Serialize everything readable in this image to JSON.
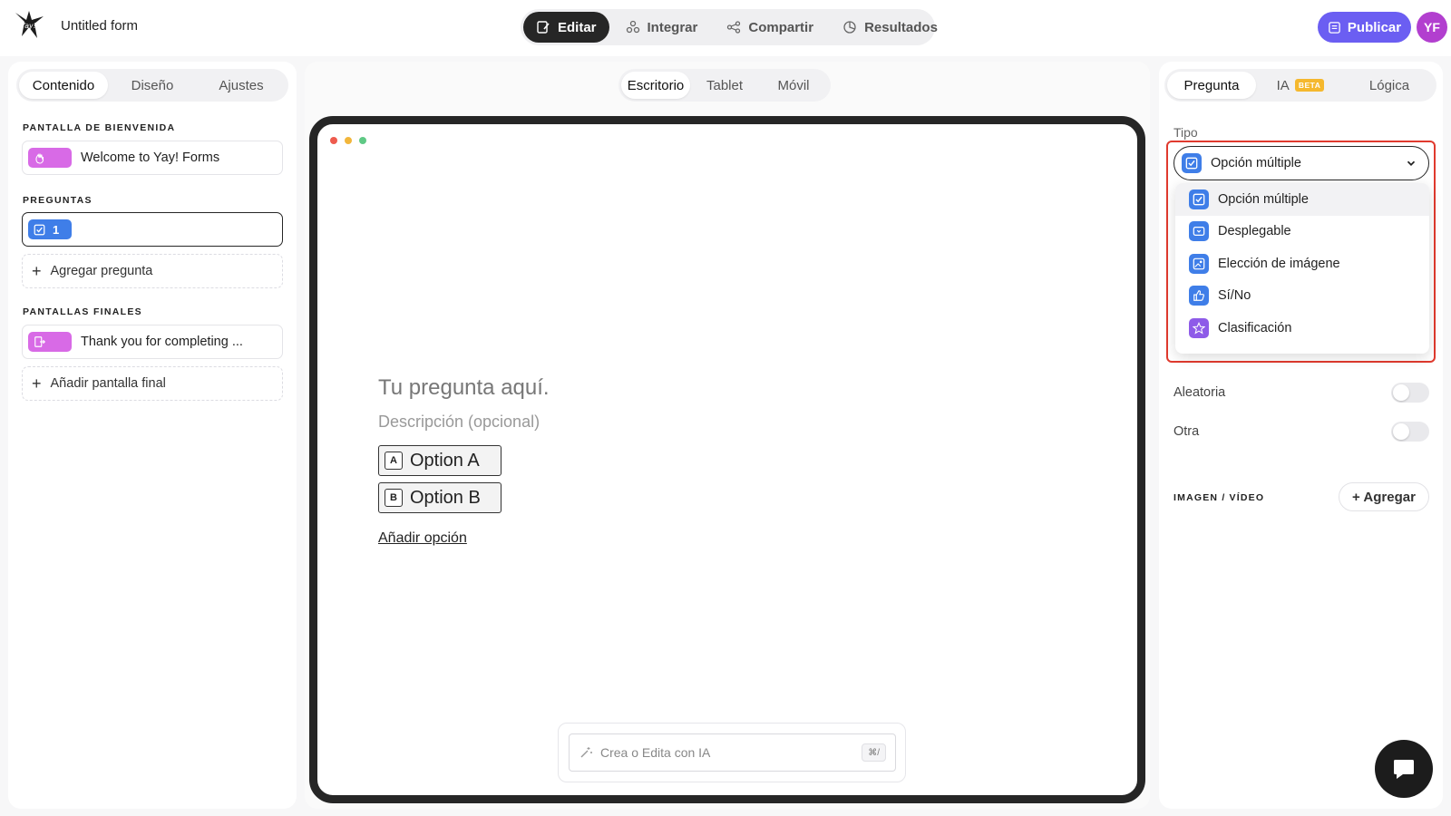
{
  "header": {
    "form_title": "Untitled form",
    "nav": [
      {
        "label": "Editar",
        "active": true
      },
      {
        "label": "Integrar",
        "active": false
      },
      {
        "label": "Compartir",
        "active": false
      },
      {
        "label": "Resultados",
        "active": false
      }
    ],
    "publish_label": "Publicar",
    "avatar_initials": "YF"
  },
  "left": {
    "tabs": [
      "Contenido",
      "Diseño",
      "Ajustes"
    ],
    "welcome_label": "PANTALLA DE BIENVENIDA",
    "welcome_card": "Welcome to Yay! Forms",
    "questions_label": "PREGUNTAS",
    "question_number": "1",
    "add_question": "Agregar pregunta",
    "endings_label": "PANTALLAS FINALES",
    "ending_card": "Thank you for completing ...",
    "add_ending": "Añadir pantalla final"
  },
  "center": {
    "device_tabs": [
      "Escritorio",
      "Tablet",
      "Móvil"
    ],
    "question_title": "Tu pregunta aquí.",
    "question_desc": "Descripción (opcional)",
    "options": [
      {
        "key": "A",
        "label": "Option A"
      },
      {
        "key": "B",
        "label": "Option B"
      }
    ],
    "add_option": "Añadir opción",
    "ai_placeholder": "Crea o Edita con IA",
    "ai_shortcut": "⌘/"
  },
  "right": {
    "tabs": [
      "Pregunta",
      "IA",
      "Lógica"
    ],
    "beta_badge": "BETA",
    "tipo_label": "Tipo",
    "selected_type": "Opción múltiple",
    "type_options": [
      {
        "label": "Opción múltiple",
        "icon": "checkbox-icon",
        "color": "#3f7ee8"
      },
      {
        "label": "Desplegable",
        "icon": "dropdown-icon",
        "color": "#3f7ee8"
      },
      {
        "label": "Elección de imágene",
        "icon": "image-choice-icon",
        "color": "#3f7ee8"
      },
      {
        "label": "Sí/No",
        "icon": "thumbs-up-icon",
        "color": "#3f7ee8"
      },
      {
        "label": "Clasificación",
        "icon": "star-icon",
        "color": "#8e5be8"
      }
    ],
    "random_label": "Aleatoria",
    "other_label": "Otra",
    "media_label": "IMAGEN / VÍDEO",
    "media_add": "+ Agregar"
  },
  "colors": {
    "accent": "#6b5ef2",
    "avatar": "#b23fcf",
    "highlight": "#e03a2e",
    "pink": "#d86ae6",
    "blue": "#3f7ee8"
  }
}
